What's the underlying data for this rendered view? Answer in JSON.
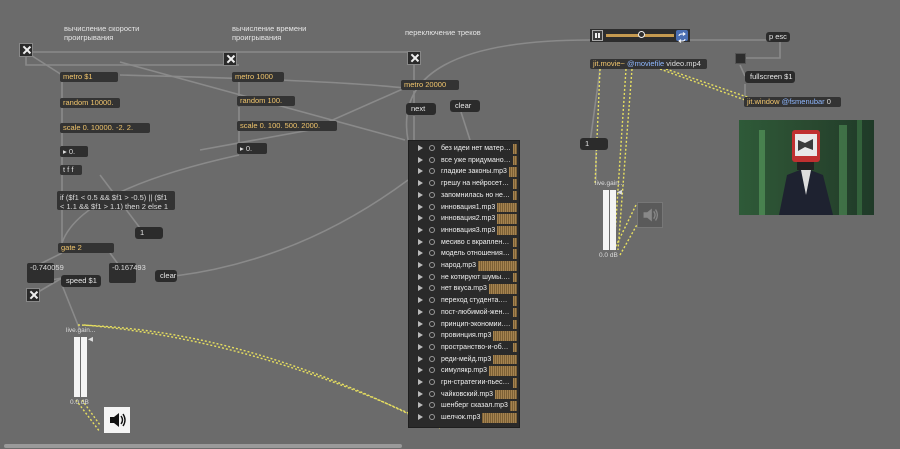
{
  "comments": {
    "speed_calc": "вычисление скорости проигрывания",
    "time_calc": "вычисление времени проигрывания",
    "track_switch": "переключение треков"
  },
  "left_column": {
    "metro": "metro $1",
    "random": "random 10000.",
    "scale": "scale 0. 10000. -2. 2.",
    "float": "0.",
    "tff": "t f f",
    "expr": "if ($f1 < 0.5 && $f1 > -0.5) || ($f1 < 1.1 && $f1 > 1.1) then 2 else 1",
    "gate": "gate 2",
    "msg_one": "1",
    "num_left": "-0.740059",
    "num_right": "-0.167493",
    "speed": "speed $1",
    "clear": "clear"
  },
  "middle_column": {
    "metro": "metro 1000",
    "random": "random 100.",
    "scale": "scale 0. 100. 500. 2000.",
    "float": "0."
  },
  "track_switcher": {
    "metro": "metro 20000",
    "next": "next",
    "clear": "clear"
  },
  "playlist": [
    "без идеи нет материа...",
    "все уже придумано.m...",
    "гладкие законы.mp3",
    "грешу на нейросети....",
    "запомнилась но не по...",
    "инновация1.mp3",
    "инновация2.mp3",
    "инновация3.mp3",
    "месиво с вкраплениа...",
    "модель отношения к...",
    "народ.mp3",
    "не котируют шумы.mp3",
    "нет вкуса.mp3",
    "переход студента.mp3",
    "пост-любимой-жены....",
    "принцип-экономии.mp3",
    "провинция.mp3",
    "пространство-и-объе...",
    "реди-мейд.mp3",
    "симулякр.mp3",
    "грн-стратегии-пьесы-...",
    "чайковский.mp3",
    "шенберг сказал.mp3",
    "шелчок.mp3"
  ],
  "gain_left": {
    "label": "live.gain...",
    "value": "0.0 dB"
  },
  "gain_right": {
    "label": "live.gain...",
    "value": "0.0 dB"
  },
  "video_section": {
    "jit_movie": "jit.movie~",
    "moviefile_attr": "@moviefile",
    "moviefile_value": "video.mp4",
    "p_esc": "p esc",
    "fullscreen": "fullscreen $1",
    "jit_window": "jit.window",
    "fsmenubar_attr": "@fsmenubar",
    "fsmenubar_value": "0",
    "msg_one": "1"
  },
  "icons": {
    "toggle": "x-toggle-icon",
    "speaker": "speaker-icon",
    "play": "play-icon",
    "pause": "pause-icon",
    "loop": "loop-icon"
  },
  "colors": {
    "canvas": "#6b6b6b",
    "object_bg": "#333333",
    "accent_gold": "#f2c66d",
    "cable_yellow": "#e8e060"
  }
}
